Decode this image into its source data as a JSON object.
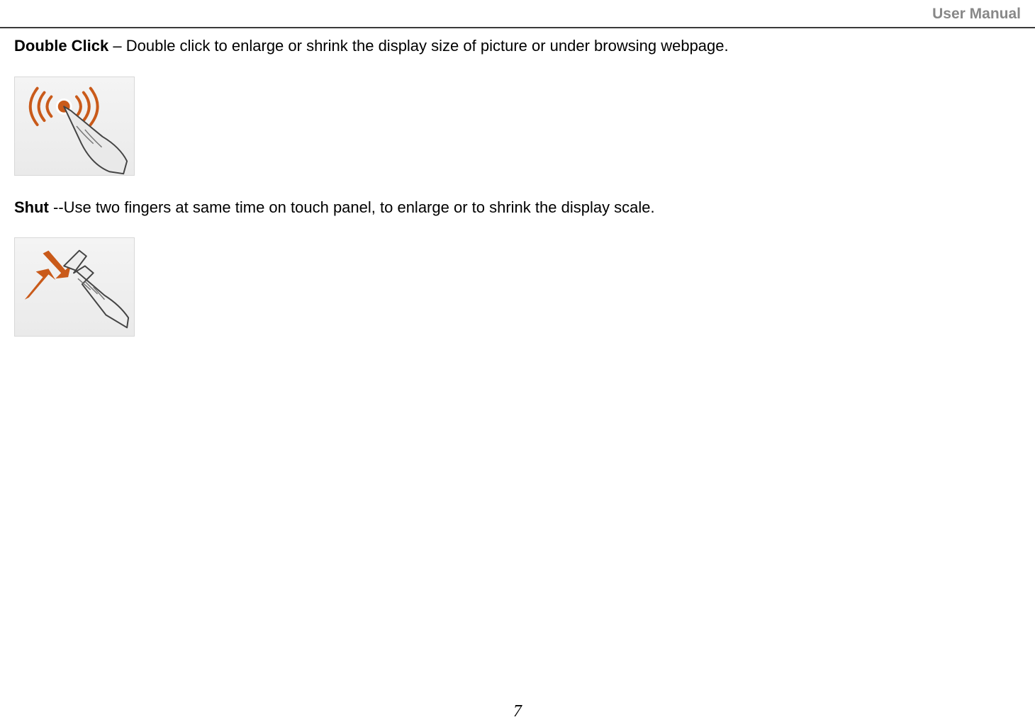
{
  "header": {
    "title": "User Manual"
  },
  "sections": {
    "double_click": {
      "label": "Double Click",
      "separator": " – ",
      "description": "Double click to enlarge or shrink the display size of picture or under browsing webpage."
    },
    "shut": {
      "label": "Shut",
      "separator": " --",
      "description": "Use two fingers at same time on touch panel, to enlarge or to shrink the display scale."
    }
  },
  "page_number": "7"
}
